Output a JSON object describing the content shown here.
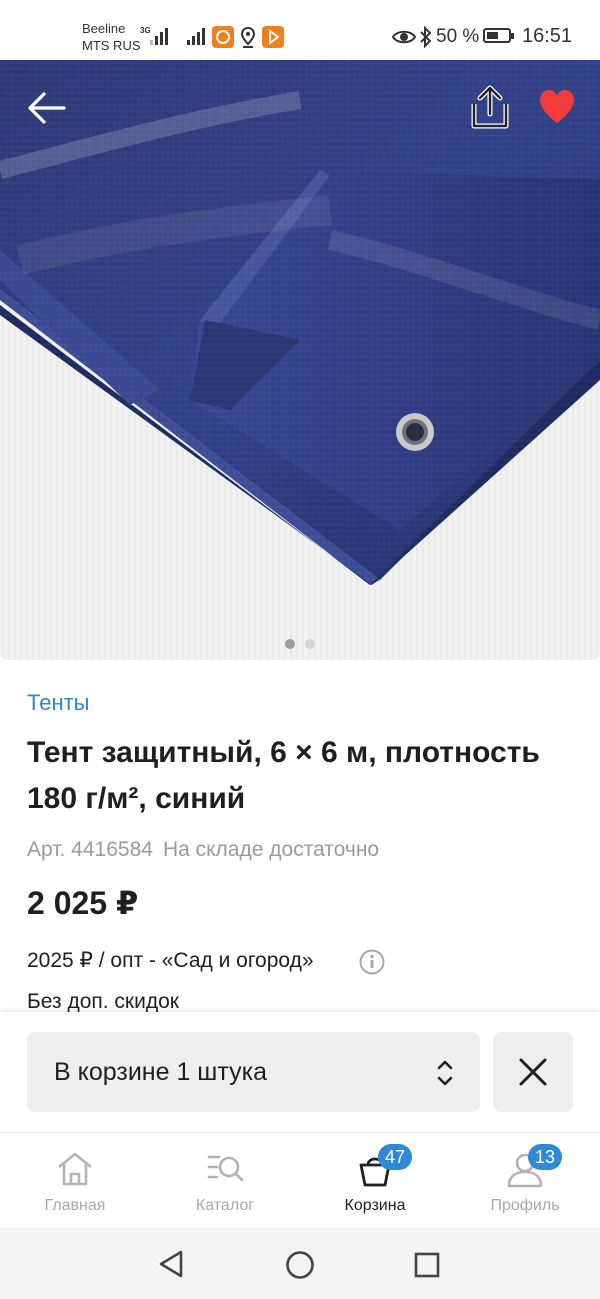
{
  "status_bar": {
    "carrier_1": "Beeline",
    "carrier_2": "MTS RUS",
    "network": "3G",
    "battery": "50 %",
    "battery_level": 0.5,
    "time": "16:51",
    "icons": [
      "signal-icon",
      "app-notification-icon",
      "location-icon",
      "play-icon",
      "eye-icon",
      "bluetooth-icon",
      "battery-icon"
    ]
  },
  "gallery": {
    "image_alt": "blue-tarp-image",
    "current_index": 1,
    "total": 2,
    "icons": [
      "back-arrow-icon",
      "share-icon",
      "heart-icon"
    ],
    "favorite_color": "#f23b3b"
  },
  "product": {
    "category": "Тенты",
    "title": "Тент защитный, 6 × 6 м, плотность 180 г/м², синий",
    "article": "Арт. 4416584",
    "stock": "На складе достаточно",
    "price": "2 025 ₽",
    "wholesale": "2025 ₽ / опт - «Сад и огород»",
    "no_discount": "Без доп. скидок"
  },
  "cart": {
    "in_cart_label": "В корзине 1 штука",
    "icons": [
      "updown-chevron-icon",
      "close-icon"
    ]
  },
  "tabs": [
    {
      "label": "Главная",
      "icon": "home-icon",
      "active": false
    },
    {
      "label": "Каталог",
      "icon": "catalog-search-icon",
      "active": false
    },
    {
      "label": "Корзина",
      "icon": "cart-bag-icon",
      "active": true,
      "badge": "47"
    },
    {
      "label": "Профиль",
      "icon": "profile-icon",
      "active": false,
      "badge": "13"
    }
  ],
  "colors": {
    "accent": "#2e88c6",
    "badge": "#2f8ad6",
    "heart": "#f23b3b",
    "tarp": "#2b3873"
  }
}
